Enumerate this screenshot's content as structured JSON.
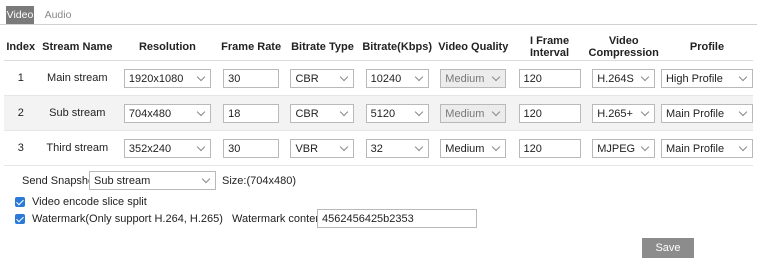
{
  "tabs": {
    "video": "Video",
    "audio": "Audio"
  },
  "table": {
    "headers": {
      "index": "Index",
      "stream_name": "Stream Name",
      "resolution": "Resolution",
      "frame_rate": "Frame Rate",
      "bitrate_type": "Bitrate Type",
      "bitrate": "Bitrate(Kbps)",
      "video_quality": "Video Quality",
      "iframe_1": "I Frame",
      "iframe_2": "Interval",
      "compression_1": "Video",
      "compression_2": "Compression",
      "profile": "Profile"
    },
    "rows": [
      {
        "index": "1",
        "stream_name": "Main stream",
        "resolution": "1920x1080",
        "frame_rate": "30",
        "bitrate_type": "CBR",
        "bitrate": "10240",
        "video_quality": "Medium",
        "iframe_interval": "120",
        "compression": "H.264S",
        "profile": "High Profile"
      },
      {
        "index": "2",
        "stream_name": "Sub stream",
        "resolution": "704x480",
        "frame_rate": "18",
        "bitrate_type": "CBR",
        "bitrate": "5120",
        "video_quality": "Medium",
        "iframe_interval": "120",
        "compression": "H.265+",
        "profile": "Main Profile"
      },
      {
        "index": "3",
        "stream_name": "Third stream",
        "resolution": "352x240",
        "frame_rate": "30",
        "bitrate_type": "VBR",
        "bitrate": "32",
        "video_quality": "Medium",
        "iframe_interval": "120",
        "compression": "MJPEG",
        "profile": "Main Profile"
      }
    ]
  },
  "snapshot": {
    "label": "Send Snapshot",
    "value": "Sub stream",
    "size": "Size:(704x480)"
  },
  "slice_split": {
    "label": "Video encode slice split",
    "checked": true
  },
  "watermark": {
    "label": "Watermark(Only support H.264, H.265)",
    "checked": true,
    "content_label": "Watermark content:",
    "content_value": "4562456425b2353"
  },
  "save_label": "Save",
  "colors": {
    "accent": "#2a7ad6",
    "active_tab": "#7a7a7a",
    "save_button": "#8c8c8c"
  }
}
